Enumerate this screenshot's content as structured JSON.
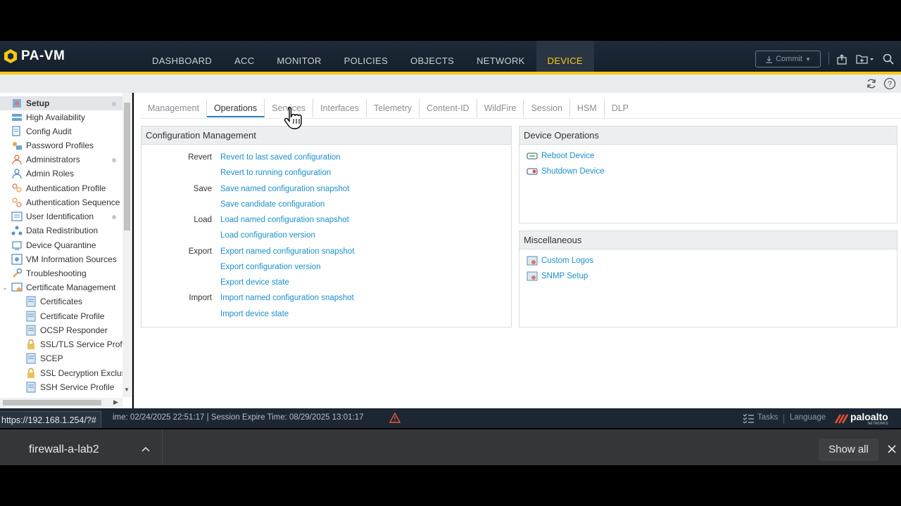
{
  "app": {
    "logo_text": "PA-VM"
  },
  "nav": {
    "items": [
      {
        "label": "DASHBOARD",
        "active": false
      },
      {
        "label": "ACC",
        "active": false
      },
      {
        "label": "MONITOR",
        "active": false
      },
      {
        "label": "POLICIES",
        "active": false
      },
      {
        "label": "OBJECTS",
        "active": false
      },
      {
        "label": "NETWORK",
        "active": false
      },
      {
        "label": "DEVICE",
        "active": true
      }
    ],
    "commit_label": "Commit"
  },
  "sidebar": {
    "items": [
      {
        "label": "Setup",
        "icon": "setup-icon",
        "selected": true,
        "dot": true
      },
      {
        "label": "High Availability",
        "icon": "ha-icon",
        "dot": false
      },
      {
        "label": "Config Audit",
        "icon": "audit-icon",
        "dot": false
      },
      {
        "label": "Password Profiles",
        "icon": "password-icon",
        "dot": false
      },
      {
        "label": "Administrators",
        "icon": "admin-icon",
        "dot": true
      },
      {
        "label": "Admin Roles",
        "icon": "role-icon",
        "dot": false
      },
      {
        "label": "Authentication Profile",
        "icon": "auth-profile-icon",
        "dot": false
      },
      {
        "label": "Authentication Sequence",
        "icon": "auth-sequence-icon",
        "dot": false
      },
      {
        "label": "User Identification",
        "icon": "user-id-icon",
        "dot": true
      },
      {
        "label": "Data Redistribution",
        "icon": "redistribution-icon",
        "dot": false
      },
      {
        "label": "Device Quarantine",
        "icon": "quarantine-icon",
        "dot": false
      },
      {
        "label": "VM Information Sources",
        "icon": "vm-icon",
        "dot": false
      },
      {
        "label": "Troubleshooting",
        "icon": "troubleshoot-icon",
        "dot": false
      },
      {
        "label": "Certificate Management",
        "icon": "cert-mgmt-icon",
        "dot": false
      },
      {
        "label": "Certificates",
        "icon": "certificate-icon",
        "dot": false
      },
      {
        "label": "Certificate Profile",
        "icon": "cert-profile-icon",
        "dot": false
      },
      {
        "label": "OCSP Responder",
        "icon": "ocsp-icon",
        "dot": false
      },
      {
        "label": "SSL/TLS Service Profile",
        "icon": "lock-icon",
        "dot": false
      },
      {
        "label": "SCEP",
        "icon": "scep-icon",
        "dot": false
      },
      {
        "label": "SSL Decryption Exclusio",
        "icon": "lock-icon",
        "dot": false
      },
      {
        "label": "SSH Service Profile",
        "icon": "ssh-icon",
        "dot": false
      }
    ]
  },
  "tabs": [
    {
      "label": "Management",
      "active": false
    },
    {
      "label": "Operations",
      "active": true
    },
    {
      "label": "Services",
      "active": false
    },
    {
      "label": "Interfaces",
      "active": false
    },
    {
      "label": "Telemetry",
      "active": false
    },
    {
      "label": "Content-ID",
      "active": false
    },
    {
      "label": "WildFire",
      "active": false
    },
    {
      "label": "Session",
      "active": false
    },
    {
      "label": "HSM",
      "active": false
    },
    {
      "label": "DLP",
      "active": false
    }
  ],
  "config_mgmt": {
    "title": "Configuration Management",
    "rows": [
      {
        "label": "Revert",
        "link": "Revert to last saved configuration"
      },
      {
        "label": "",
        "link": "Revert to running configuration"
      },
      {
        "label": "Save",
        "link": "Save named configuration snapshot"
      },
      {
        "label": "",
        "link": "Save candidate configuration"
      },
      {
        "label": "Load",
        "link": "Load named configuration snapshot"
      },
      {
        "label": "",
        "link": "Load configuration version"
      },
      {
        "label": "Export",
        "link": "Export named configuration snapshot"
      },
      {
        "label": "",
        "link": "Export configuration version"
      },
      {
        "label": "",
        "link": "Export device state"
      },
      {
        "label": "Import",
        "link": "Import named configuration snapshot"
      },
      {
        "label": "",
        "link": "Import device state"
      }
    ]
  },
  "device_ops": {
    "title": "Device Operations",
    "items": [
      {
        "label": "Reboot Device",
        "icon": "reboot-icon"
      },
      {
        "label": "Shutdown Device",
        "icon": "shutdown-icon"
      }
    ]
  },
  "misc": {
    "title": "Miscellaneous",
    "items": [
      {
        "label": "Custom Logos",
        "icon": "logos-icon"
      },
      {
        "label": "SNMP Setup",
        "icon": "snmp-icon"
      }
    ]
  },
  "status": {
    "url_tooltip": "https://192.168.1.254/?#",
    "text": "ime: 02/24/2025 22:51:17 | Session Expire Time: 08/29/2025 13:01:17",
    "tasks_label": "Tasks",
    "language_label": "Language",
    "brand": "paloalto",
    "brand_sub": "NETWORKS"
  },
  "downloads": {
    "file_name": "firewall-a-lab2",
    "show_all_label": "Show all"
  },
  "colors": {
    "accent": "#f6c912",
    "link": "#1c8fc9",
    "nav_bg": "#1e2a38"
  }
}
